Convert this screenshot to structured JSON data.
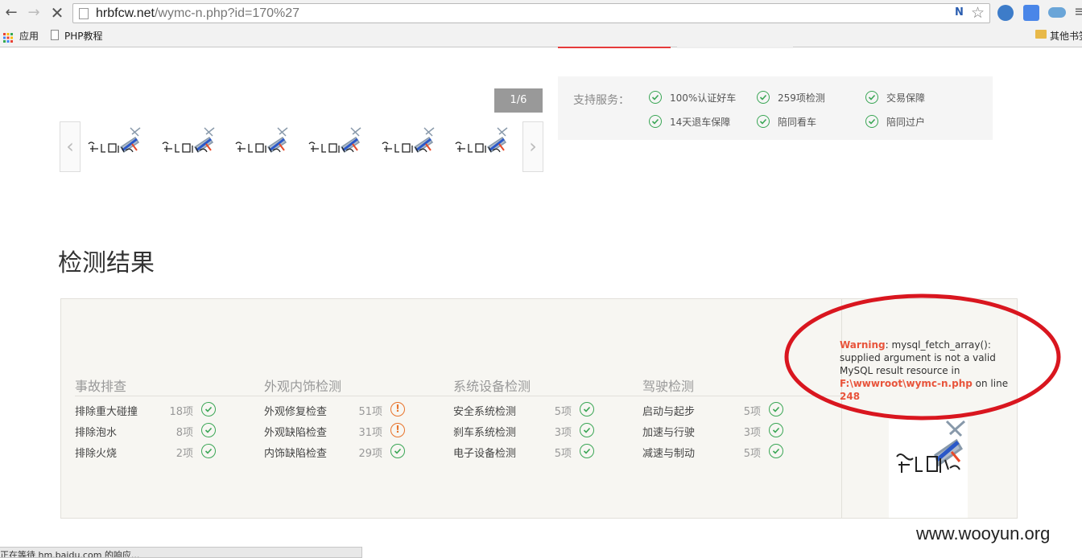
{
  "browser": {
    "url_host": "hrbfcw.net",
    "url_path": "/wymc-n.php?id=170%27",
    "bookmarks": [
      "应用",
      "PHP教程"
    ],
    "other_bookmarks": "其他书签",
    "status_text": "正在等待 hm.baidu.com 的响应..."
  },
  "gallery": {
    "pager": "1/6",
    "image_alt": "暂无图片",
    "thumb_count": 6
  },
  "services": {
    "label": "支持服务：",
    "items": [
      "100%认证好车",
      "259项检测",
      "交易保障",
      "14天退车保障",
      "陪同看车",
      "陪同过户"
    ]
  },
  "results": {
    "title": "检测结果",
    "categories": [
      {
        "name": "事故排查",
        "items": [
          {
            "label": "排除重大碰撞",
            "count": "18项",
            "status": "ok"
          },
          {
            "label": "排除泡水",
            "count": "8项",
            "status": "ok"
          },
          {
            "label": "排除火烧",
            "count": "2项",
            "status": "ok"
          }
        ]
      },
      {
        "name": "外观内饰检测",
        "items": [
          {
            "label": "外观修复检查",
            "count": "51项",
            "status": "warn"
          },
          {
            "label": "外观缺陷检查",
            "count": "31项",
            "status": "warn"
          },
          {
            "label": "内饰缺陷检查",
            "count": "29项",
            "status": "ok"
          }
        ]
      },
      {
        "name": "系统设备检测",
        "items": [
          {
            "label": "安全系统检测",
            "count": "5项",
            "status": "ok"
          },
          {
            "label": "刹车系统检测",
            "count": "3项",
            "status": "ok"
          },
          {
            "label": "电子设备检测",
            "count": "5项",
            "status": "ok"
          }
        ]
      },
      {
        "name": "驾驶检测",
        "items": [
          {
            "label": "启动与起步",
            "count": "5项",
            "status": "ok"
          },
          {
            "label": "加速与行驶",
            "count": "3项",
            "status": "ok"
          },
          {
            "label": "减速与制动",
            "count": "5项",
            "status": "ok"
          }
        ]
      }
    ]
  },
  "php_warning": {
    "label": "Warning",
    "message": ": mysql_fetch_array(): supplied argument is not a valid MySQL result resource in ",
    "file": "F:\\wwwroot\\wymc-n.php",
    "on_line": " on line ",
    "line": "248"
  },
  "watermark": "www.wooyun.org",
  "colors": {
    "check": "#3aa655",
    "warn": "#e8732b",
    "warning_text": "#e8543b",
    "annotation": "#d9161f",
    "accent": "#e63b3b"
  }
}
